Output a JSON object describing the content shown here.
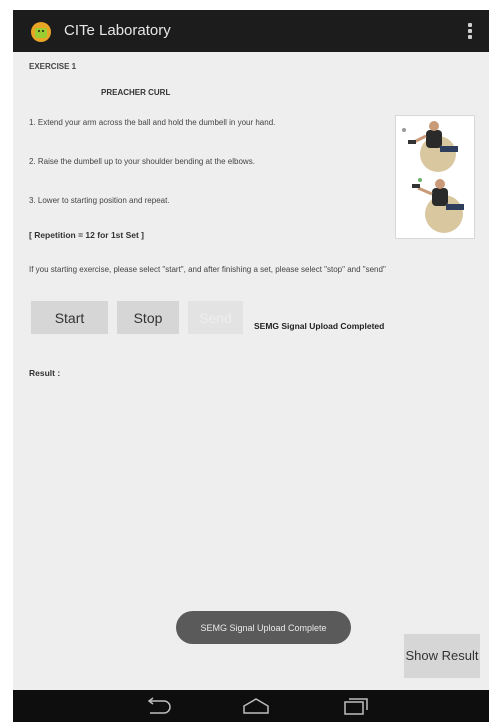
{
  "app": {
    "title": "CITe Laboratory",
    "menu_icon": "overflow-menu-icon",
    "app_icon": "android-app-icon"
  },
  "exercise": {
    "label": "EXERCISE 1",
    "name": "PREACHER CURL",
    "steps": [
      "1. Extend your arm across the ball and hold the dumbell in your hand.",
      "2. Raise the dumbell up to your shoulder bending at the elbows.",
      "3. Lower to starting position and repeat."
    ],
    "repetition": "[ Repetition = 12 for 1st Set ]",
    "instructions": "If you starting exercise, please select \"start\", and after finishing a set, please select \"stop\" and \"send\"",
    "figure": "exercise-illustration"
  },
  "controls": {
    "start_label": "Start",
    "stop_label": "Stop",
    "send_label": "Send",
    "upload_status": "SEMG Signal Upload Completed"
  },
  "result": {
    "label": "Result :"
  },
  "toast": "SEMG Signal Upload Complete",
  "show_result_label": "Show Result",
  "navbar": {
    "icons": [
      "back-icon",
      "home-icon",
      "recent-apps-icon"
    ]
  }
}
